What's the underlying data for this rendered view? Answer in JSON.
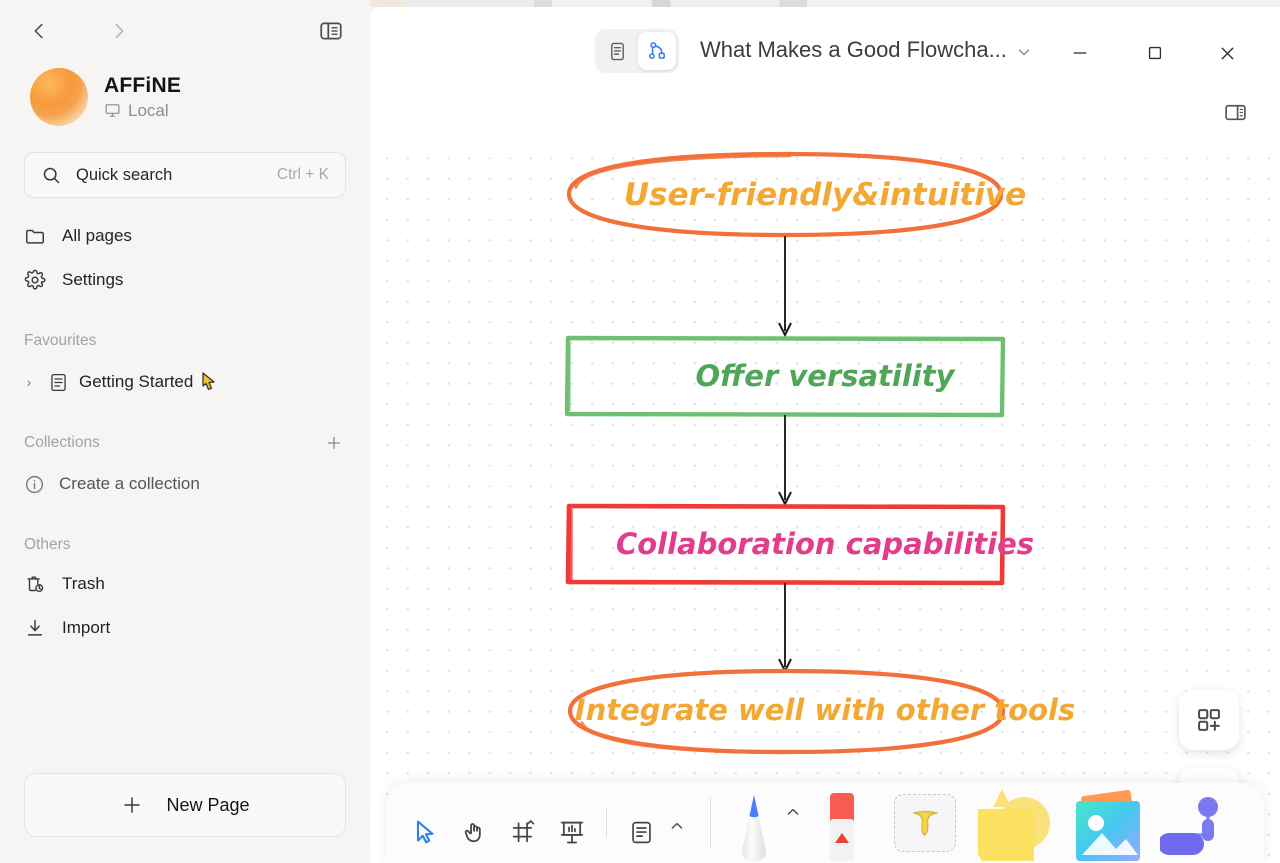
{
  "sidebar": {
    "nav": {
      "back_icon": "chevron-left-icon",
      "forward_icon": "chevron-right-icon",
      "panel_icon": "sidebar-toggle-icon"
    },
    "workspace": {
      "name": "AFFiNE",
      "status": "Local",
      "status_icon": "monitor-icon",
      "avatar": "workspace-avatar"
    },
    "search": {
      "label": "Quick search",
      "shortcut": "Ctrl + K",
      "icon": "search-icon"
    },
    "items": [
      {
        "label": "All pages",
        "icon": "folder-icon"
      },
      {
        "label": "Settings",
        "icon": "gear-icon"
      }
    ],
    "favourites": {
      "title": "Favourites",
      "entries": [
        {
          "label": "Getting Started",
          "icon": "page-icon",
          "badge_icon": "cursor-pointer-icon"
        }
      ]
    },
    "collections": {
      "title": "Collections",
      "add_icon": "plus-icon",
      "entries": [
        {
          "label": "Create a collection",
          "icon": "info-icon"
        }
      ]
    },
    "others": {
      "title": "Others",
      "entries": [
        {
          "label": "Trash",
          "icon": "trash-icon"
        },
        {
          "label": "Import",
          "icon": "download-icon"
        }
      ]
    },
    "new_page": {
      "label": "New Page",
      "icon": "plus-icon"
    }
  },
  "window": {
    "title": "What Makes a Good Flowcha...",
    "title_chevron_icon": "chevron-down-icon",
    "minimize_icon": "minimize-icon",
    "maximize_icon": "maximize-icon",
    "close_icon": "close-icon",
    "right_panel_icon": "right-sidebar-toggle-icon",
    "modes": [
      {
        "name": "page-mode",
        "icon": "page-mode-icon",
        "active": false
      },
      {
        "name": "edgeless-mode",
        "icon": "edgeless-mode-icon",
        "active": true
      }
    ]
  },
  "canvas": {
    "nodes": [
      {
        "id": "n1",
        "shape": "ellipse",
        "text": "User-friendly&intuitive",
        "stroke": "#F2703A",
        "text_color": "#F2A833"
      },
      {
        "id": "n2",
        "shape": "rect",
        "text": "Offer versatility",
        "stroke": "#6FBF73",
        "text_color": "#4FA659"
      },
      {
        "id": "n3",
        "shape": "rect",
        "text": "Collaboration capabilities",
        "stroke": "#EE3B38",
        "text_color": "#E23C8A"
      },
      {
        "id": "n4",
        "shape": "ellipse",
        "text": "Integrate well with other tools",
        "stroke": "#F2703A",
        "text_color": "#F2A833"
      }
    ],
    "connectors": [
      {
        "from": "n1",
        "to": "n2"
      },
      {
        "from": "n2",
        "to": "n3"
      },
      {
        "from": "n3",
        "to": "n4"
      }
    ],
    "float_buttons": [
      {
        "name": "add-template-button",
        "icon": "template-grid-plus-icon"
      },
      {
        "name": "help-button",
        "icon": "question-bubble-icon"
      }
    ]
  },
  "toolbar": {
    "tools": [
      {
        "name": "select-tool",
        "icon": "cursor-arrow-icon",
        "active": true
      },
      {
        "name": "pan-tool",
        "icon": "hand-icon",
        "active": false
      },
      {
        "name": "frame-tool",
        "icon": "frame-icon",
        "active": false
      },
      {
        "name": "present-tool",
        "icon": "presentation-icon",
        "active": false
      }
    ],
    "note_tool": {
      "name": "note-tool",
      "icon": "note-doc-icon",
      "chevron_icon": "chevron-up-icon"
    },
    "pen_tool": {
      "name": "pen-tool",
      "icon": "pen-icon",
      "chevron_icon": "chevron-up-icon"
    },
    "eraser_tool": {
      "name": "eraser-tool",
      "icon": "eraser-icon"
    },
    "text_tool": {
      "name": "text-tool",
      "icon": "text-t-icon"
    },
    "shape_tool": {
      "name": "shape-tool",
      "icon": "shapes-icon"
    },
    "image_tool": {
      "name": "image-tool",
      "icon": "image-icon"
    },
    "connector_tool": {
      "name": "connector-tool",
      "icon": "connector-icon"
    }
  }
}
